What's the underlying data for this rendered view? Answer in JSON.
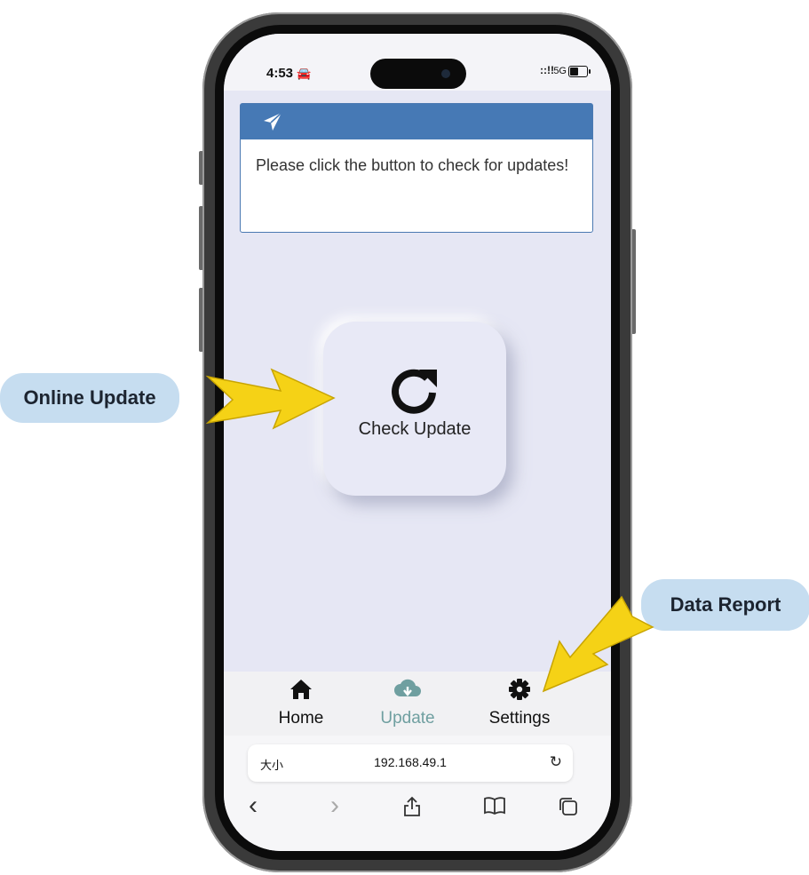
{
  "status_bar": {
    "time": "4:53",
    "car_icon": "🚘",
    "signal": "::!!",
    "network": "5G"
  },
  "card": {
    "icon": "paper-plane-icon",
    "message": " Please click the button to check for updates!"
  },
  "check_update": {
    "label": "Check Update",
    "icon": "refresh-icon"
  },
  "tabs": [
    {
      "label": "Home",
      "icon": "home-icon",
      "active": false
    },
    {
      "label": "Update",
      "icon": "cloud-download-icon",
      "active": true
    },
    {
      "label": "Settings",
      "icon": "gear-icon",
      "active": false
    }
  ],
  "browser": {
    "text_size_label": "大小",
    "url": "192.168.49.1",
    "reload_glyph": "↻"
  },
  "toolbar": {
    "back": "‹",
    "forward": "›",
    "share": "⇪",
    "bookmarks": "bookmarks-icon",
    "tabs": "tabs-icon"
  },
  "callouts": {
    "online_update": "Online Update",
    "data_report": "Data Report"
  },
  "colors": {
    "card_header": "#4679b5",
    "screen_bg": "#e6e7f4",
    "active_tab": "#6f9fa0",
    "callout_bg": "#c6ddf0",
    "arrow": "#f5d216"
  }
}
